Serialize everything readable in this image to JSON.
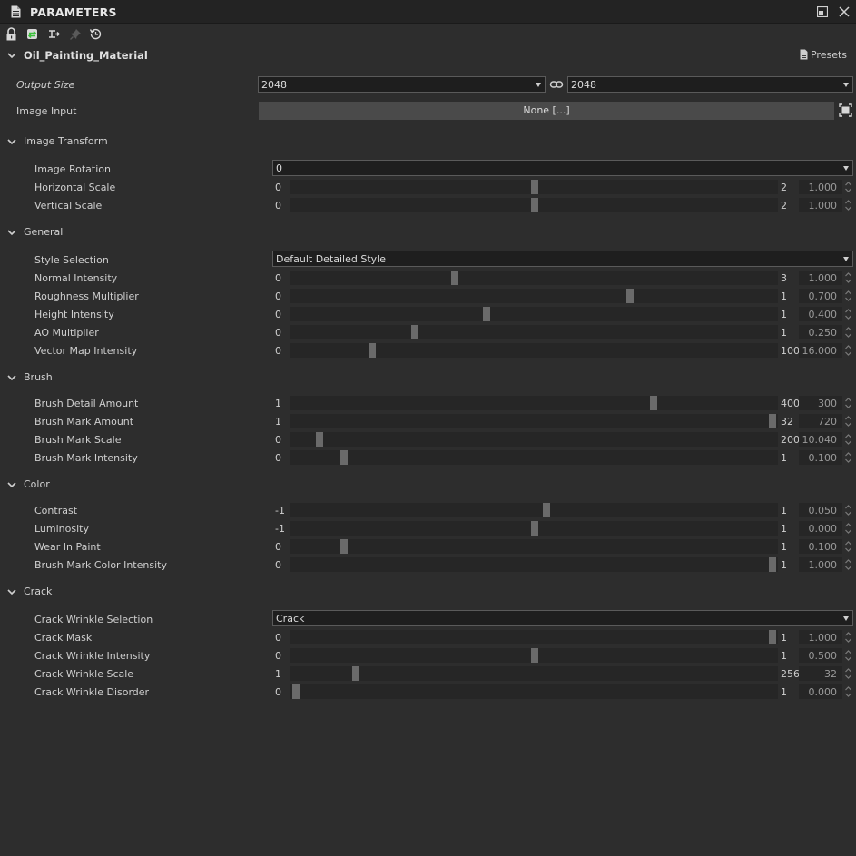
{
  "window": {
    "title": "PARAMETERS"
  },
  "material": {
    "name": "Oil_Painting_Material",
    "presets_label": "Presets"
  },
  "output_size": {
    "label": "Output Size",
    "width": "2048",
    "height": "2048"
  },
  "image_input": {
    "label": "Image Input",
    "button_label": "None [...]"
  },
  "sections": {
    "image_transform": {
      "title": "Image Transform",
      "rotation": {
        "label": "Image Rotation",
        "value": "0"
      },
      "sliders": [
        {
          "label": "Horizontal Scale",
          "min": "0",
          "max": "2",
          "value": "1.000",
          "fraction": 0.5
        },
        {
          "label": "Vertical Scale",
          "min": "0",
          "max": "2",
          "value": "1.000",
          "fraction": 0.5
        }
      ]
    },
    "general": {
      "title": "General",
      "style": {
        "label": "Style Selection",
        "value": "Default Detailed Style"
      },
      "sliders": [
        {
          "label": "Normal Intensity",
          "min": "0",
          "max": "3",
          "value": "1.000",
          "fraction": 0.333
        },
        {
          "label": "Roughness Multiplier",
          "min": "0",
          "max": "1",
          "value": "0.700",
          "fraction": 0.7
        },
        {
          "label": "Height Intensity",
          "min": "0",
          "max": "1",
          "value": "0.400",
          "fraction": 0.4
        },
        {
          "label": "AO Multiplier",
          "min": "0",
          "max": "1",
          "value": "0.250",
          "fraction": 0.25
        },
        {
          "label": "Vector Map Intensity",
          "min": "0",
          "max": "100",
          "value": "16.000",
          "fraction": 0.16
        }
      ]
    },
    "brush": {
      "title": "Brush",
      "sliders": [
        {
          "label": "Brush Detail Amount",
          "min": "1",
          "max": "400",
          "value": "300",
          "fraction": 0.75
        },
        {
          "label": "Brush Mark Amount",
          "min": "1",
          "max": "32",
          "value": "720",
          "fraction": 1.0
        },
        {
          "label": "Brush Mark Scale",
          "min": "0",
          "max": "200",
          "value": "10.040",
          "fraction": 0.05
        },
        {
          "label": "Brush Mark Intensity",
          "min": "0",
          "max": "1",
          "value": "0.100",
          "fraction": 0.1
        }
      ]
    },
    "color": {
      "title": "Color",
      "sliders": [
        {
          "label": "Contrast",
          "min": "-1",
          "max": "1",
          "value": "0.050",
          "fraction": 0.525
        },
        {
          "label": "Luminosity",
          "min": "-1",
          "max": "1",
          "value": "0.000",
          "fraction": 0.5
        },
        {
          "label": "Wear In Paint",
          "min": "0",
          "max": "1",
          "value": "0.100",
          "fraction": 0.1
        },
        {
          "label": "Brush Mark Color Intensity",
          "min": "0",
          "max": "1",
          "value": "1.000",
          "fraction": 1.0
        }
      ]
    },
    "crack": {
      "title": "Crack",
      "selection": {
        "label": "Crack Wrinkle Selection",
        "value": "Crack"
      },
      "sliders": [
        {
          "label": "Crack Mask",
          "min": "0",
          "max": "1",
          "value": "1.000",
          "fraction": 1.0
        },
        {
          "label": "Crack Wrinkle Intensity",
          "min": "0",
          "max": "1",
          "value": "0.500",
          "fraction": 0.5
        },
        {
          "label": "Crack Wrinkle Scale",
          "min": "1",
          "max": "256",
          "value": "32",
          "fraction": 0.125
        },
        {
          "label": "Crack Wrinkle Disorder",
          "min": "0",
          "max": "1",
          "value": "0.000",
          "fraction": 0.0
        }
      ]
    }
  }
}
